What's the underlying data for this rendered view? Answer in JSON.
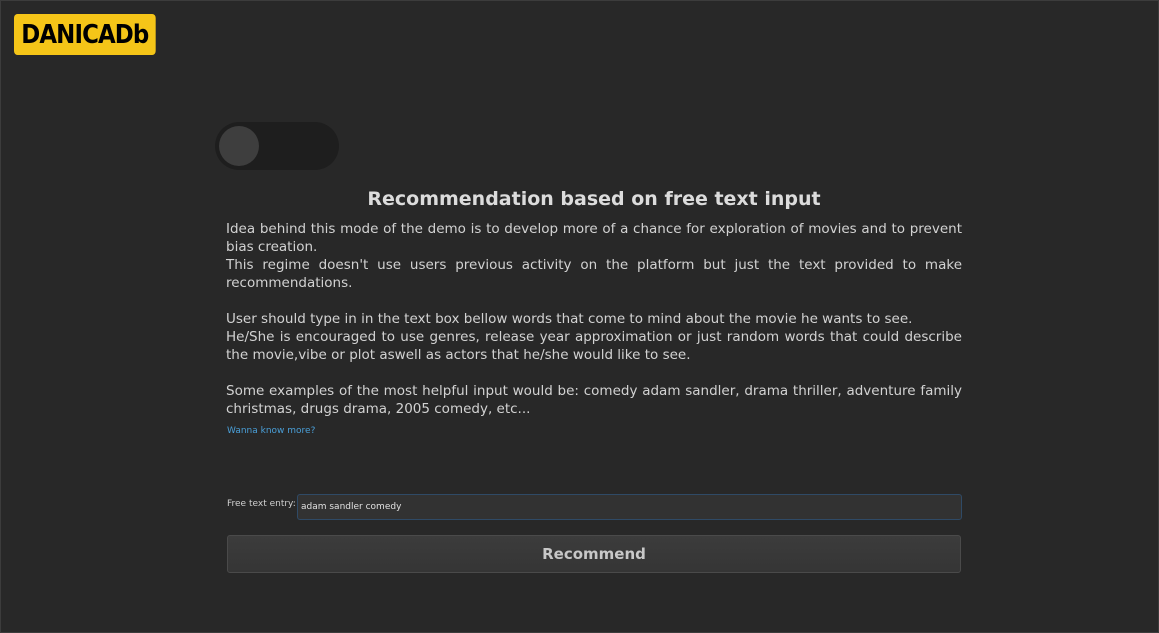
{
  "app": {
    "logo_text": "DANICADb",
    "brand_color": "#f5c518",
    "accent_color": "#4a9fd8"
  },
  "mode_toggle": {
    "state": "off"
  },
  "main": {
    "title": "Recommendation based on free text input",
    "paragraphs": [
      "Idea behind this mode of the demo is to develop more of a chance for exploration of movies and to prevent bias creation.",
      "This regime doesn't use users previous activity on the platform but just the text provided to make recommendations.",
      "",
      "User should type in in the text box bellow words that come to mind about the movie he wants to see.",
      "He/She is encouraged to use genres, release year approximation or just random words that could describe the movie,vibe or plot aswell as actors that he/she would like to see.",
      "",
      "Some examples of the most helpful input would be: comedy adam sandler, drama thriller, adventure family christmas, drugs drama, 2005 comedy, etc..."
    ],
    "more_link": "Wanna know more?"
  },
  "entry": {
    "label": "Free text entry:",
    "value": "adam sandler comedy"
  },
  "recommend_button": {
    "label": "Recommend"
  }
}
